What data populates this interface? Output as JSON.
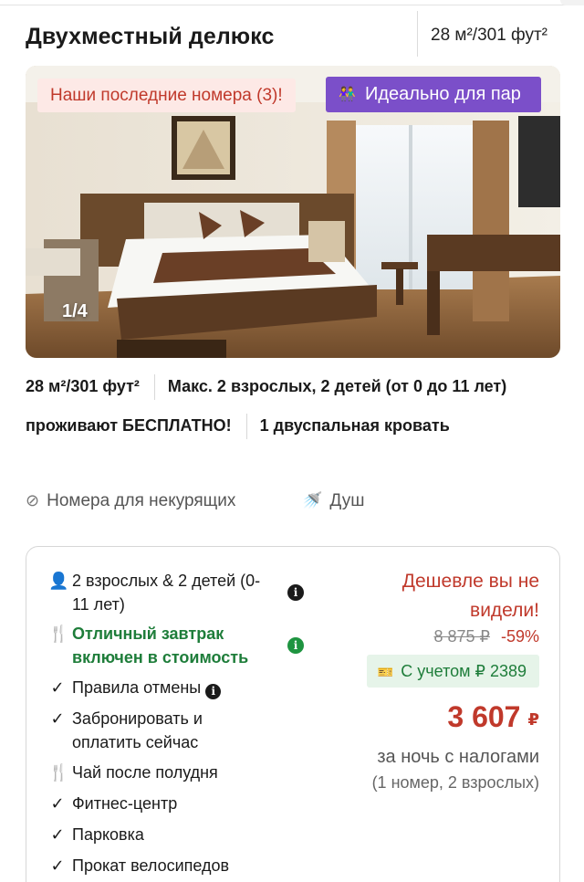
{
  "header": {
    "title": "Двухместный делюкс",
    "size": "28 м²/301 фут²"
  },
  "photo": {
    "badge_last_rooms": "Наши последние номера (3)!",
    "badge_couples": "Идеально для пар",
    "counter": "1/4"
  },
  "facts": {
    "size": "28 м²/301 фут²",
    "occupancy": "Макс. 2 взрослых, 2 детей (от 0 до 11 лет) проживают БЕСПЛАТНО!",
    "bed": "1 двуспальная кровать"
  },
  "amenities": [
    {
      "icon": "no-smoking-icon",
      "label": "Номера для некурящих"
    },
    {
      "icon": "shower-icon",
      "label": "Душ"
    }
  ],
  "offer": {
    "features": [
      {
        "icon": "person-icon",
        "text": "2 взрослых & 2 детей (0-11 лет)",
        "info": true
      },
      {
        "icon": "cutlery-icon",
        "text": "Отличный завтрак включен в стоимость",
        "info": true,
        "highlight": true
      },
      {
        "icon": "check-icon",
        "text": "Правила отмены",
        "info_inline": true
      },
      {
        "icon": "check-icon",
        "text": "Забронировать и оплатить сейчас"
      },
      {
        "icon": "cutlery-icon",
        "text": "Чай после полудня"
      },
      {
        "icon": "check-icon",
        "text": "Фитнес-центр"
      },
      {
        "icon": "check-icon",
        "text": "Парковка"
      },
      {
        "icon": "check-icon",
        "text": "Прокат велосипедов"
      }
    ],
    "price": {
      "cheaper_label": "Дешевле вы не видели!",
      "old_price": "8 875 ₽",
      "discount": "-59%",
      "coupon": "С учетом ₽ 2389",
      "price": "3 607",
      "currency": "₽",
      "per_night": "за ночь с налогами",
      "rooms_guests": "(1 номер, 2 взрослых)"
    }
  },
  "colors": {
    "accent_red": "#c0392b",
    "accent_green": "#1e7d3a",
    "badge_purple": "#7b4fc9"
  }
}
